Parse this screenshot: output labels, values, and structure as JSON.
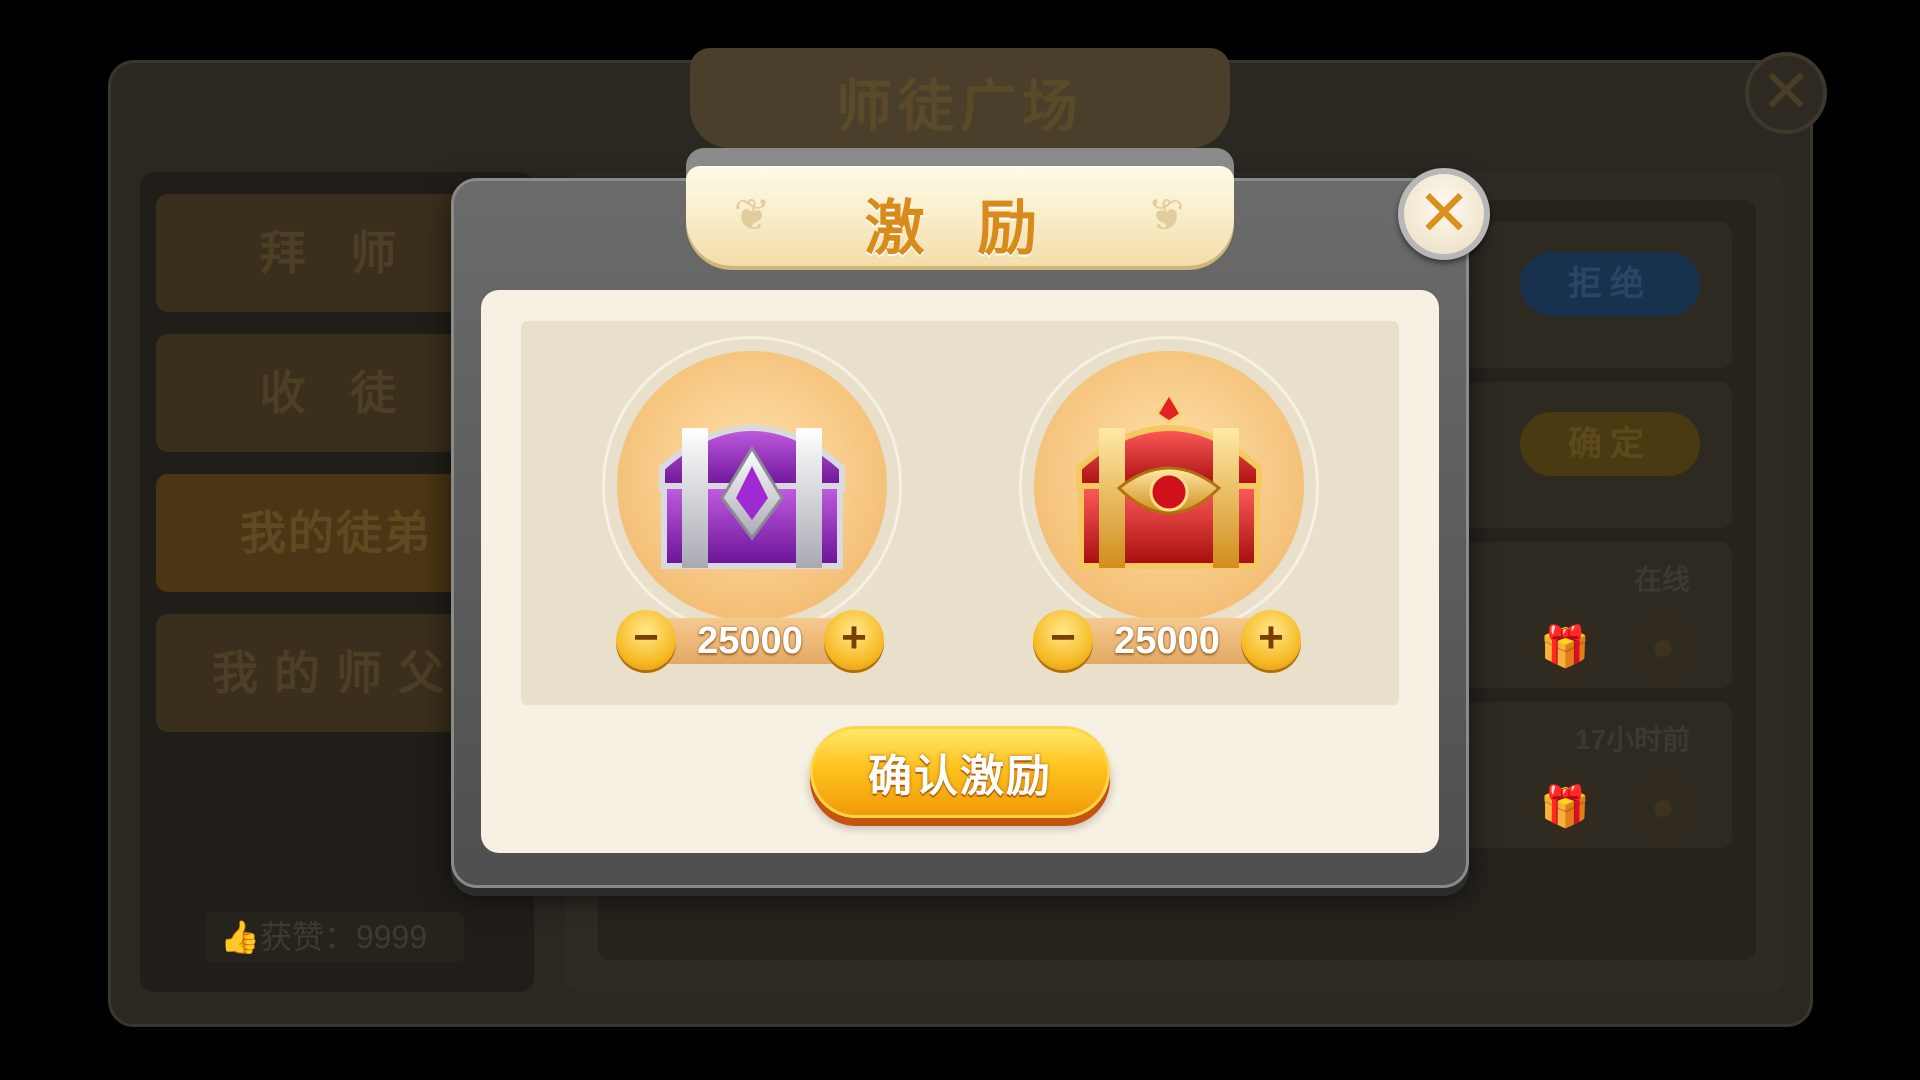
{
  "background": {
    "title": "师徒广场",
    "close_glyph": "✕",
    "menu": [
      {
        "label": "拜 师"
      },
      {
        "label": "收 徒"
      },
      {
        "label": "我的徒弟"
      },
      {
        "label": "我的师父"
      }
    ],
    "likes_text": "👍获赞：9999",
    "reject_label": "拒绝",
    "ok_label": "确定",
    "online_label": "在线",
    "time_label": "17小时前"
  },
  "modal": {
    "title": "激 励",
    "close_glyph": "✕",
    "chests": [
      {
        "name": "purple-silver-chest",
        "value": "25000",
        "minus": "−",
        "plus": "+"
      },
      {
        "name": "red-gold-chest",
        "value": "25000",
        "minus": "−",
        "plus": "+"
      }
    ],
    "confirm_label": "确认激励"
  },
  "colors": {
    "accent_gold": "#ffc21d",
    "title_orange": "#d88a1a",
    "panel_cream": "#f7f1e3"
  }
}
